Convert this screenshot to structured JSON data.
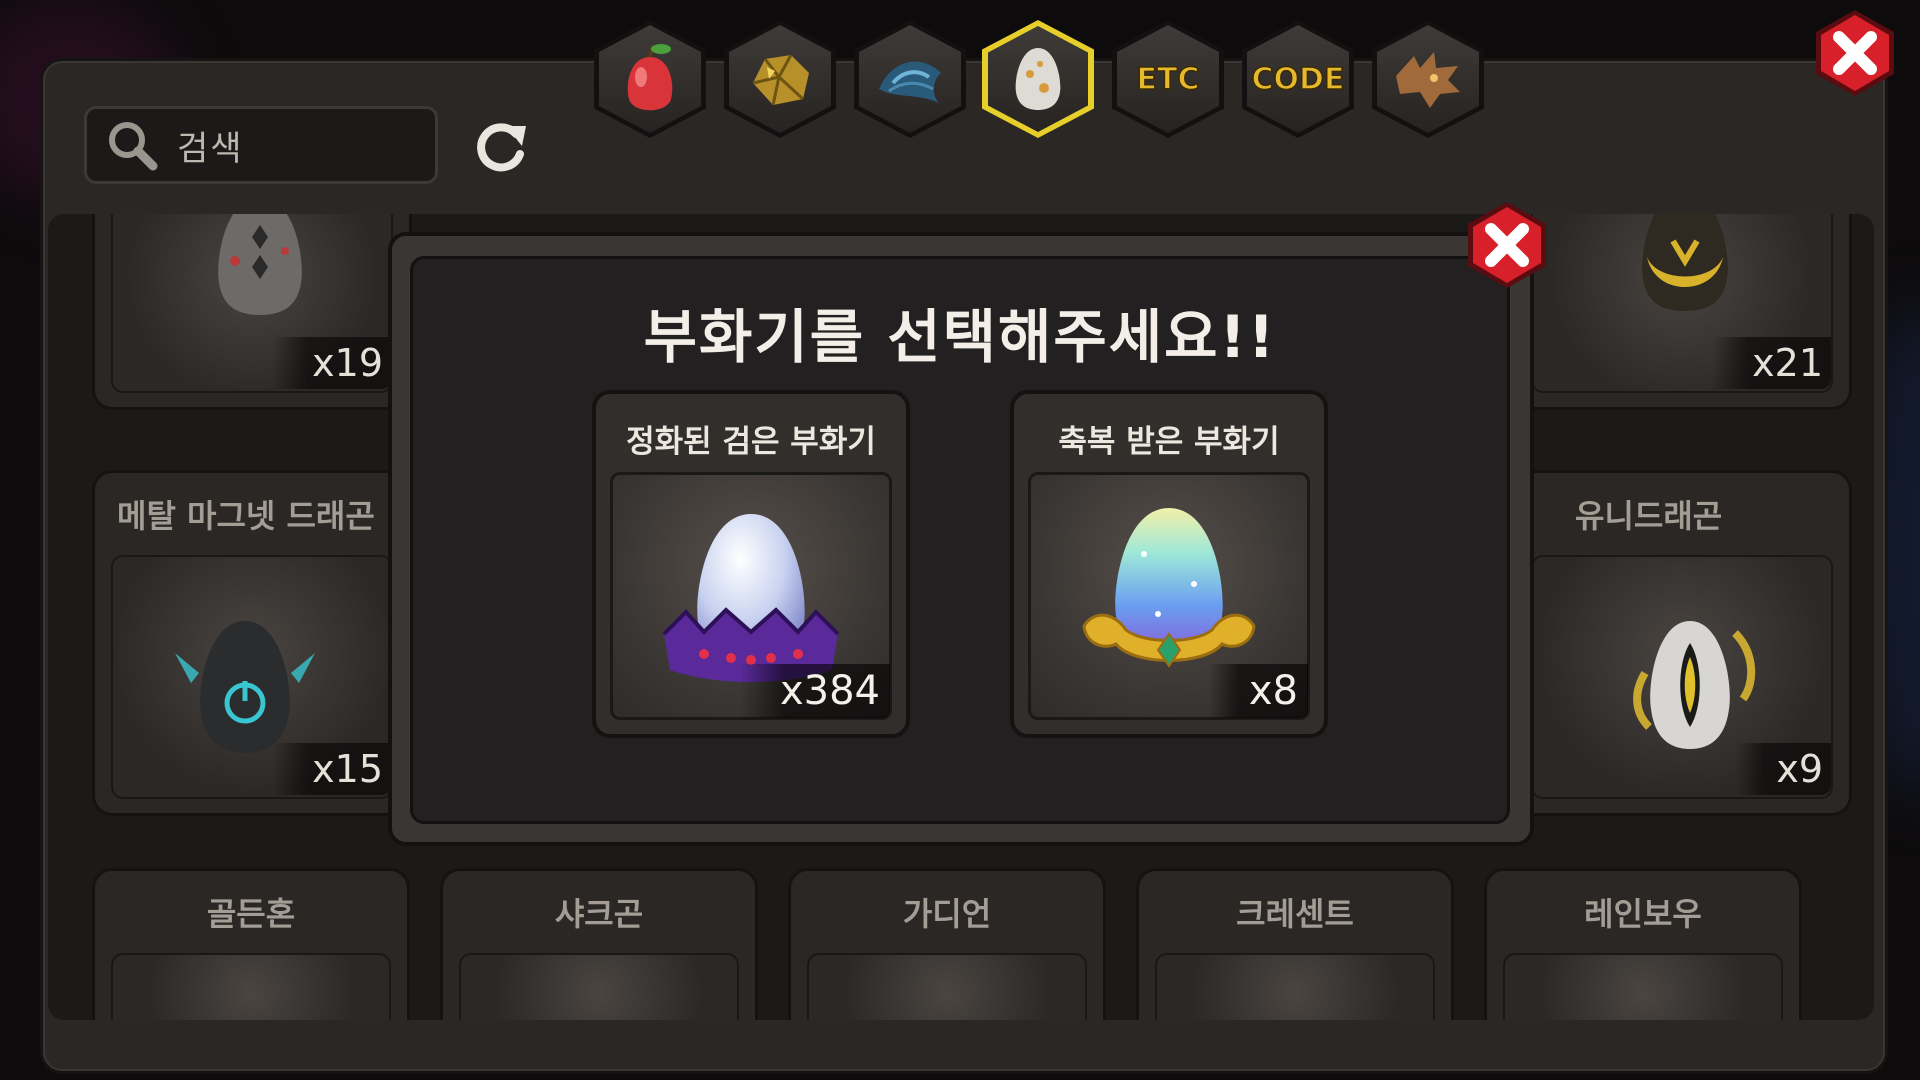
{
  "search": {
    "placeholder": "검색"
  },
  "tabs": [
    {
      "icon": "fruit-icon",
      "label": ""
    },
    {
      "icon": "ore-icon",
      "label": ""
    },
    {
      "icon": "scale-icon",
      "label": ""
    },
    {
      "icon": "egg-icon",
      "label": "",
      "active": true
    },
    {
      "icon": "etc-tab",
      "label": "ETC"
    },
    {
      "icon": "code-tab",
      "label": "CODE"
    },
    {
      "icon": "dragon-head-icon",
      "label": ""
    }
  ],
  "list": {
    "cards": [
      {
        "title": "",
        "count": "x19"
      },
      {
        "title": "",
        "count": "x21"
      },
      {
        "title": "메탈 마그넷 드래곤",
        "count": "x15"
      },
      {
        "title": "유니드래곤",
        "count": "x9"
      },
      {
        "title": "골든혼"
      },
      {
        "title": "샤크곤"
      },
      {
        "title": "가디언"
      },
      {
        "title": "크레센트"
      },
      {
        "title": "레인보우"
      }
    ]
  },
  "modal": {
    "title": "부화기를 선택해주세요!!",
    "options": [
      {
        "name": "정화된 검은 부화기",
        "count": "x384"
      },
      {
        "name": "축복 받은 부화기",
        "count": "x8"
      }
    ]
  },
  "colors": {
    "active_tab_border": "#e6cf2a",
    "close_button_red": "#d8202a",
    "tab_label_yellow": "#e6b92c"
  }
}
